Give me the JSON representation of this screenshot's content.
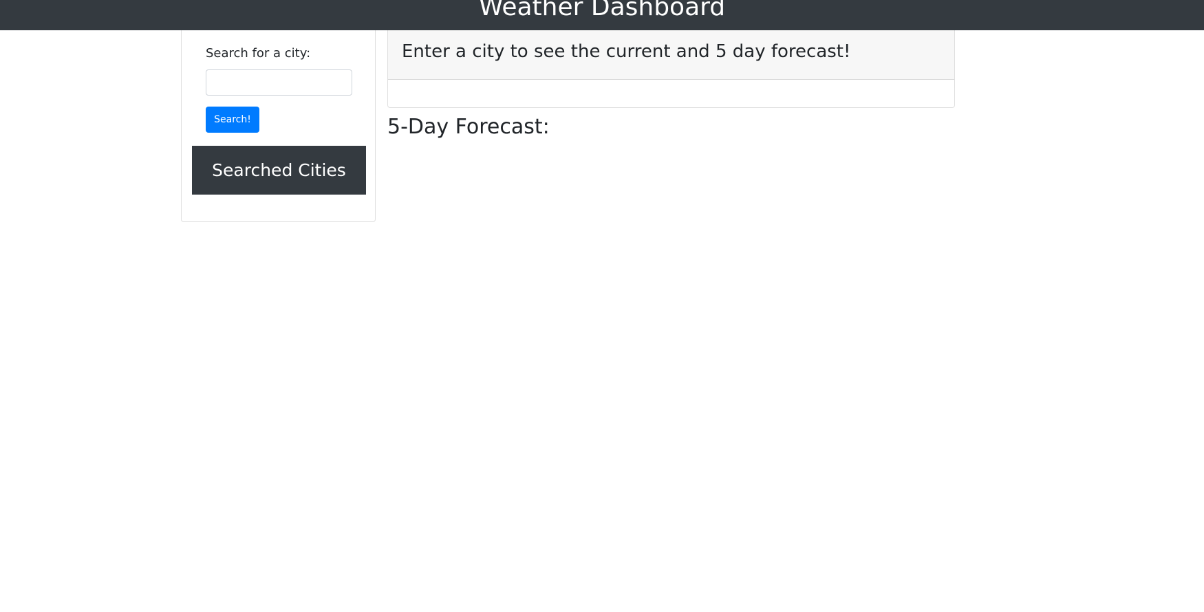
{
  "header": {
    "title": "Weather Dashboard"
  },
  "sidebar": {
    "search_label": "Search for a city:",
    "search_input_value": "",
    "search_input_placeholder": "",
    "search_button_label": "Search!",
    "searched_cities_title": "Searched Cities"
  },
  "main": {
    "current_card_prompt": "Enter a city to see the current and 5 day forecast!",
    "forecast_title": "5-Day Forecast:"
  },
  "colors": {
    "navbar": "#343a40",
    "primary_button": "#007bff",
    "card_header": "#f7f7f7"
  }
}
